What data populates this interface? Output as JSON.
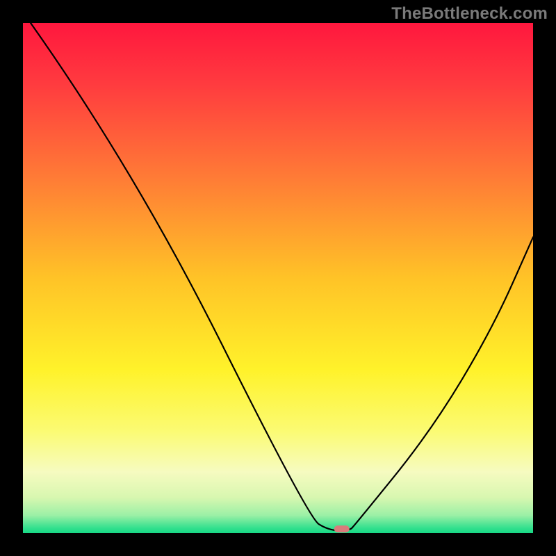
{
  "watermark": "TheBottleneck.com",
  "chart_data": {
    "type": "line",
    "title": "",
    "xlabel": "",
    "ylabel": "",
    "x_range": [
      0,
      100
    ],
    "y_range": [
      0,
      100
    ],
    "curve": [
      {
        "x": 1.5,
        "y": 100
      },
      {
        "x": 22,
        "y": 71
      },
      {
        "x": 56,
        "y": 3
      },
      {
        "x": 60,
        "y": 0.5
      },
      {
        "x": 64,
        "y": 0.5
      },
      {
        "x": 65,
        "y": 1.5
      },
      {
        "x": 80,
        "y": 20
      },
      {
        "x": 92,
        "y": 40
      },
      {
        "x": 100,
        "y": 58
      }
    ],
    "marker": {
      "x": 62.5,
      "y": 0.8,
      "color": "#d97b7b"
    },
    "background": {
      "type": "vertical-gradient",
      "stops": [
        {
          "pos": 0.0,
          "color": "#ff173e"
        },
        {
          "pos": 0.12,
          "color": "#ff3b3f"
        },
        {
          "pos": 0.3,
          "color": "#ff7a36"
        },
        {
          "pos": 0.5,
          "color": "#ffc327"
        },
        {
          "pos": 0.68,
          "color": "#fff22a"
        },
        {
          "pos": 0.8,
          "color": "#fbfb73"
        },
        {
          "pos": 0.88,
          "color": "#f6fbc0"
        },
        {
          "pos": 0.93,
          "color": "#d8f7b0"
        },
        {
          "pos": 0.965,
          "color": "#9cf0a6"
        },
        {
          "pos": 0.99,
          "color": "#33e08e"
        },
        {
          "pos": 1.0,
          "color": "#17d885"
        }
      ]
    }
  }
}
